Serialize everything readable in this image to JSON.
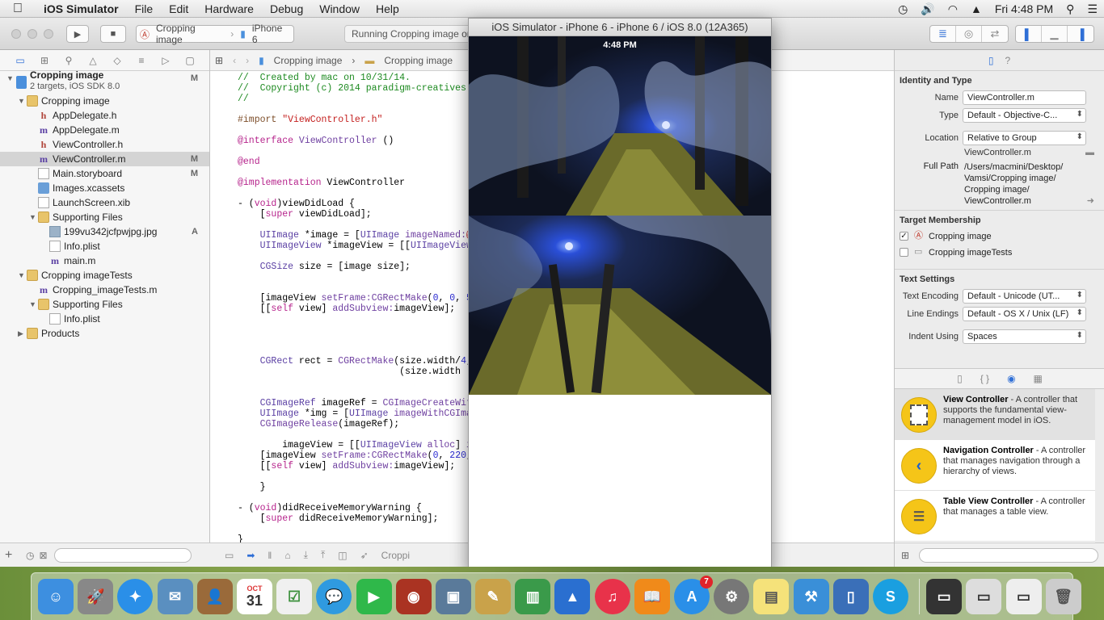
{
  "menubar": {
    "apple": "",
    "app_name": "iOS Simulator",
    "items": [
      "File",
      "Edit",
      "Hardware",
      "Debug",
      "Window",
      "Help"
    ],
    "clock": "Fri 4:48 PM"
  },
  "toolbar": {
    "scheme_target": "Cropping image",
    "scheme_device": "iPhone 6",
    "activity": "Running Cropping image on"
  },
  "navigator": {
    "project_name": "Cropping image",
    "project_sub": "2 targets, iOS SDK 8.0",
    "project_status": "M",
    "items": [
      {
        "label": "Cropping image",
        "icon": "folder",
        "status": ""
      },
      {
        "label": "AppDelegate.h",
        "icon": "h",
        "status": ""
      },
      {
        "label": "AppDelegate.m",
        "icon": "m",
        "status": ""
      },
      {
        "label": "ViewController.h",
        "icon": "h",
        "status": ""
      },
      {
        "label": "ViewController.m",
        "icon": "m",
        "status": "M"
      },
      {
        "label": "Main.storyboard",
        "icon": "doc",
        "status": "M"
      },
      {
        "label": "Images.xcassets",
        "icon": "assets",
        "status": ""
      },
      {
        "label": "LaunchScreen.xib",
        "icon": "doc",
        "status": ""
      },
      {
        "label": "Supporting Files",
        "icon": "folder",
        "status": ""
      },
      {
        "label": "199vu342jcfpwjpg.jpg",
        "icon": "img",
        "status": "A"
      },
      {
        "label": "Info.plist",
        "icon": "doc",
        "status": ""
      },
      {
        "label": "main.m",
        "icon": "m",
        "status": ""
      },
      {
        "label": "Cropping imageTests",
        "icon": "folder",
        "status": ""
      },
      {
        "label": "Cropping_imageTests.m",
        "icon": "m",
        "status": ""
      },
      {
        "label": "Supporting Files",
        "icon": "folder",
        "status": ""
      },
      {
        "label": "Info.plist",
        "icon": "doc",
        "status": ""
      },
      {
        "label": "Products",
        "icon": "folder",
        "status": ""
      }
    ]
  },
  "editor": {
    "jump_1": "Cropping image",
    "jump_2": "Cropping image",
    "debug_label": "Croppi"
  },
  "simulator": {
    "title": "iOS Simulator - iPhone 6 - iPhone 6 / iOS 8.0 (12A365)",
    "status_time": "4:48 PM"
  },
  "inspector": {
    "identity_title": "Identity and Type",
    "name_label": "Name",
    "name_value": "ViewController.m",
    "type_label": "Type",
    "type_value": "Default - Objective-C...",
    "location_label": "Location",
    "location_value": "Relative to Group",
    "location_file": "ViewController.m",
    "fullpath_label": "Full Path",
    "fullpath_lines": [
      "/Users/macmini/Desktop/",
      "Vamsi/Cropping image/",
      "Cropping image/",
      "ViewController.m"
    ],
    "membership_title": "Target Membership",
    "membership": [
      {
        "label": "Cropping image",
        "checked": "✓"
      },
      {
        "label": "Cropping imageTests",
        "checked": ""
      }
    ],
    "text_title": "Text Settings",
    "encoding_label": "Text Encoding",
    "encoding_value": "Default - Unicode (UT...",
    "endings_label": "Line Endings",
    "endings_value": "Default - OS X / Unix (LF)",
    "indent_label": "Indent Using",
    "indent_value": "Spaces"
  },
  "library": {
    "items": [
      {
        "name": "View Controller",
        "desc": " - A controller that supports the fundamental view-management model in iOS."
      },
      {
        "name": "Navigation Controller",
        "desc": " - A controller that manages navigation through a hierarchy of views."
      },
      {
        "name": "Table View Controller",
        "desc": " - A controller that manages a table view."
      }
    ]
  },
  "dock": {
    "calendar_month": "OCT",
    "calendar_day": "31",
    "appstore_badge": "7"
  },
  "colors": {
    "accent": "#2f6fd6",
    "selection": "#d4d4d4"
  }
}
